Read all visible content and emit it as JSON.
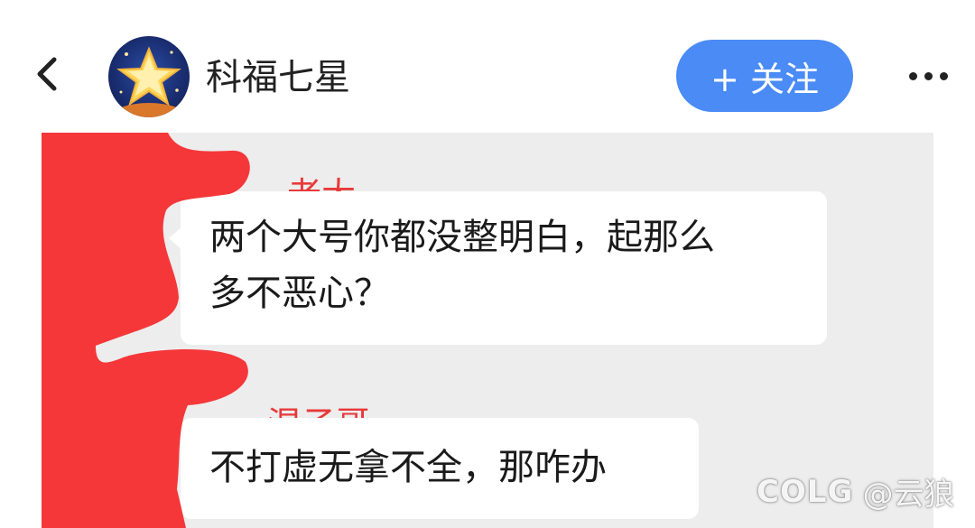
{
  "header": {
    "account_name": "科福七星",
    "follow_label": "+ 关注"
  },
  "messages": [
    {
      "sender": "老大",
      "lines": [
        "两个大号你都没整明白，起那么",
        "多不恶心？"
      ]
    },
    {
      "sender": "混子哥",
      "lines": [
        "不打虚无拿不全，那咋办"
      ]
    }
  ],
  "watermark": {
    "logo": "COLG",
    "user": "@云狼"
  },
  "colors": {
    "follow_button": "#4a8bf5",
    "sender_name": "#e8393a",
    "redaction": "#f5373a",
    "chat_background": "#ededed"
  }
}
